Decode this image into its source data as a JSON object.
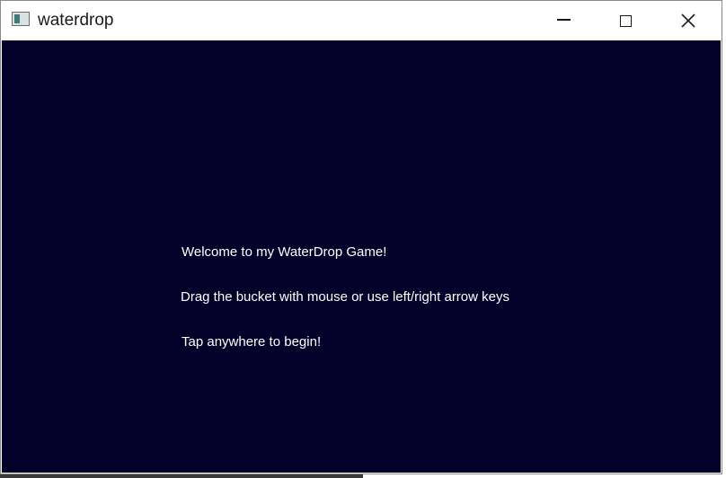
{
  "window": {
    "title": "waterdrop",
    "icons": {
      "app": "app-window-icon",
      "minimize": "minimize-icon",
      "maximize": "maximize-icon",
      "close": "close-icon"
    }
  },
  "game": {
    "background_color": "#03002a",
    "text_color": "#ffffff",
    "welcome_text": "Welcome to my WaterDrop Game!",
    "instructions_text": "Drag the bucket with mouse or use left/right arrow keys",
    "start_text": "Tap anywhere to begin!"
  }
}
